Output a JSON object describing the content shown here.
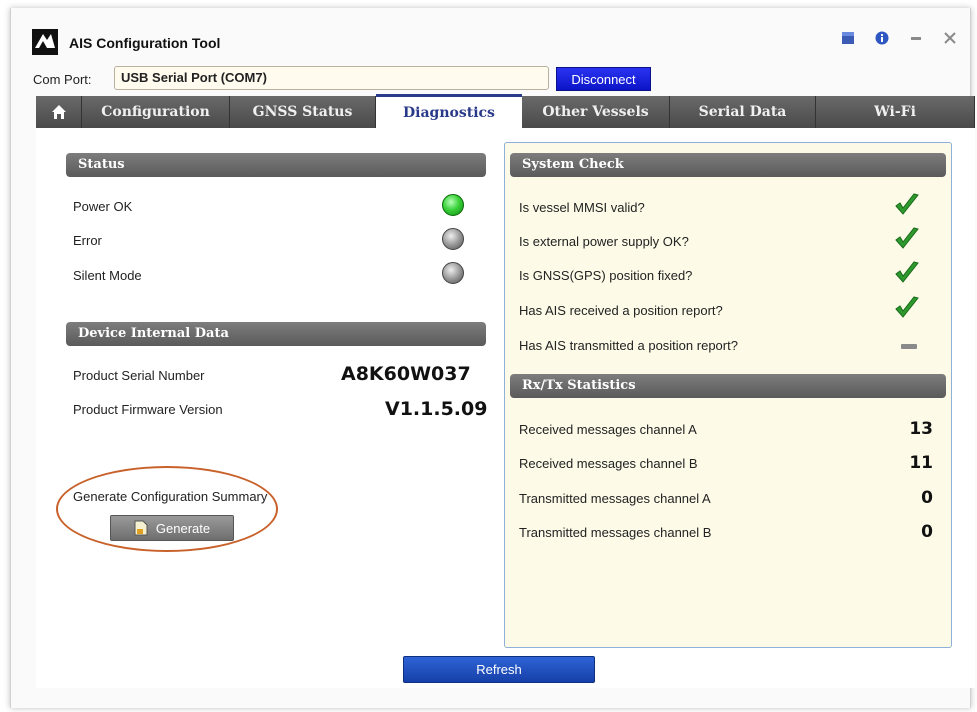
{
  "app": {
    "title": "AIS Configuration Tool"
  },
  "window_controls": {
    "icons": [
      "app-menu-icon",
      "info-icon",
      "minimize-icon",
      "close-icon"
    ]
  },
  "comport": {
    "label": "Com Port:",
    "value": "USB Serial Port (COM7)",
    "button": "Disconnect"
  },
  "tabs": [
    {
      "label": "",
      "icon": "home-icon"
    },
    {
      "label": "Configuration"
    },
    {
      "label": "GNSS Status"
    },
    {
      "label": "Diagnostics",
      "active": true
    },
    {
      "label": "Other Vessels"
    },
    {
      "label": "Serial Data"
    },
    {
      "label": "Wi-Fi"
    }
  ],
  "status": {
    "title": "Status",
    "items": [
      {
        "label": "Power OK",
        "state": "on"
      },
      {
        "label": "Error",
        "state": "off"
      },
      {
        "label": "Silent Mode",
        "state": "off"
      }
    ]
  },
  "device": {
    "title": "Device Internal Data",
    "serial_label": "Product Serial Number",
    "serial_value": "A8K60W037",
    "firmware_label": "Product Firmware Version",
    "firmware_value": "V1.1.5.09"
  },
  "generate": {
    "label": "Generate Configuration Summary",
    "button": "Generate"
  },
  "system_check": {
    "title": "System Check",
    "items": [
      {
        "label": "Is vessel MMSI valid?",
        "result": "check"
      },
      {
        "label": "Is external power supply OK?",
        "result": "check"
      },
      {
        "label": "Is GNSS(GPS) position fixed?",
        "result": "check"
      },
      {
        "label": "Has AIS received a position report?",
        "result": "check"
      },
      {
        "label": "Has AIS transmitted a position report?",
        "result": "dash"
      }
    ]
  },
  "stats": {
    "title": "Rx/Tx Statistics",
    "items": [
      {
        "label": "Received messages channel A",
        "value": "13"
      },
      {
        "label": "Received messages channel B",
        "value": "11"
      },
      {
        "label": "Transmitted messages channel A",
        "value": "0"
      },
      {
        "label": "Transmitted messages channel B",
        "value": "0"
      }
    ]
  },
  "refresh": {
    "button": "Refresh"
  },
  "colors": {
    "accent": "#2a3a8a",
    "highlight": "#c8612a",
    "panel_bg": "#fdfbe8",
    "check": "#2e9a2e"
  }
}
